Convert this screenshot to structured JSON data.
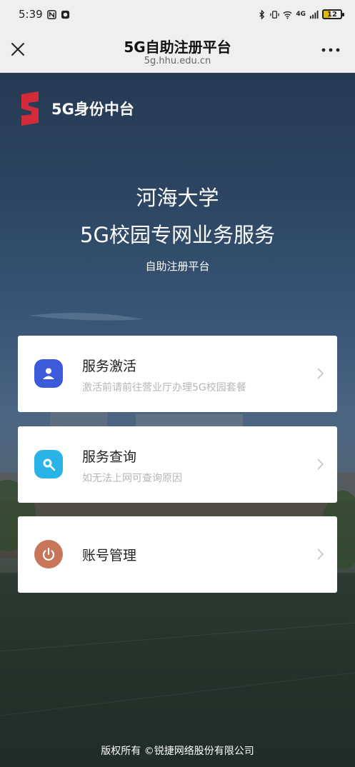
{
  "status_bar": {
    "time": "5:39",
    "signal_label": "4G",
    "battery_level": "12"
  },
  "header": {
    "title": "5G自助注册平台",
    "url": "5g.hhu.edu.cn"
  },
  "brand": {
    "name": "5G身份中台"
  },
  "hero": {
    "line1": "河海大学",
    "line2": "5G校园专网业务服务",
    "line3": "自助注册平台"
  },
  "cards": [
    {
      "title": "服务激活",
      "subtitle": "激活前请前往营业厅办理5G校园套餐",
      "icon": "user-icon",
      "color": "#3b5bdb"
    },
    {
      "title": "服务查询",
      "subtitle": "如无法上网可查询原因",
      "icon": "search-icon",
      "color": "#2ab3e6"
    },
    {
      "title": "账号管理",
      "subtitle": "",
      "icon": "power-icon",
      "color": "#c8755a"
    }
  ],
  "footer": {
    "copyright": "版权所有 ©锐捷网络股份有限公司"
  }
}
